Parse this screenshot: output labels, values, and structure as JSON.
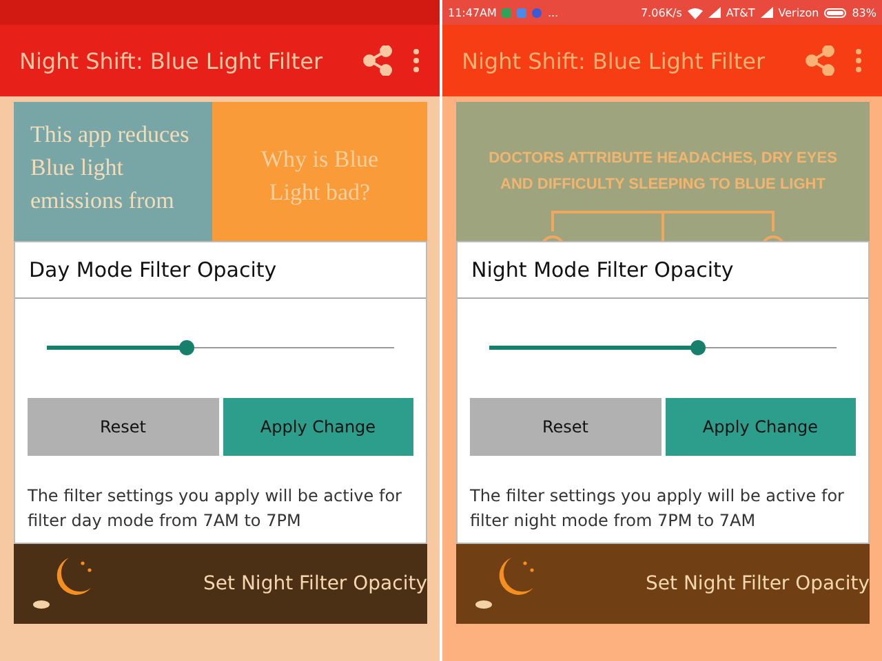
{
  "panels": [
    {
      "night_filter": false,
      "app_bar": {
        "title": "Night Shift: Blue Light Filter"
      },
      "card": {
        "kind": "split",
        "texts": [
          "This app reduces Blue light emissions from",
          "Why is Blue Light bad?"
        ]
      },
      "dialog": {
        "title": "Day Mode Filter Opacity",
        "level": 0.4,
        "buttons": [
          "Reset",
          "Apply Change"
        ],
        "note": "The filter settings you apply will be active for filter day mode from 7AM to 7PM"
      },
      "footer": {
        "text": "Set Night Filter Opacity"
      }
    },
    {
      "night_filter": true,
      "status_bar": {
        "time": "11:47AM",
        "more": "...",
        "speed": "7.06K/s",
        "carriers": [
          "AT&T",
          "Verizon"
        ],
        "battery": "83%"
      },
      "app_bar": {
        "title": "Night Shift: Blue Light Filter"
      },
      "card": {
        "kind": "poster",
        "text": "DOCTORS ATTRIBUTE HEADACHES, DRY EYES AND DIFFICULTY SLEEPING TO BLUE LIGHT"
      },
      "dialog": {
        "title": "Night Mode Filter Opacity",
        "level": 0.6,
        "buttons": [
          "Reset",
          "Apply Change"
        ],
        "note": "The filter settings you apply will be active for filter night mode from 7PM to 7AM"
      },
      "footer": {
        "text": "Set Night Filter Opacity"
      }
    }
  ]
}
